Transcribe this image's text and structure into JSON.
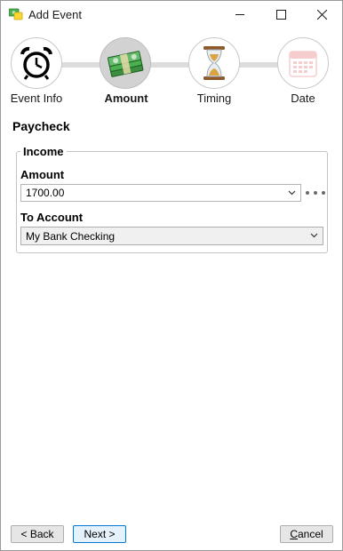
{
  "window": {
    "title": "Add Event"
  },
  "steps": [
    {
      "label": "Event Info",
      "icon": "alarm-clock-icon",
      "active": false
    },
    {
      "label": "Amount",
      "icon": "money-stack-icon",
      "active": true
    },
    {
      "label": "Timing",
      "icon": "hourglass-icon",
      "active": false
    },
    {
      "label": "Date",
      "icon": "calendar-icon",
      "active": false
    }
  ],
  "page": {
    "title": "Paycheck"
  },
  "income_group": {
    "legend": "Income",
    "amount_label": "Amount",
    "amount_value": "1700.00",
    "to_account_label": "To Account",
    "to_account_value": "My Bank Checking"
  },
  "buttons": {
    "back": "< Back",
    "next": "Next >",
    "cancel_prefix": "",
    "cancel_underlined": "C",
    "cancel_rest": "ancel"
  },
  "colors": {
    "accent": "#0078d4",
    "money_green": "#2e7d32",
    "step_active_bg": "#d2d2d2"
  }
}
